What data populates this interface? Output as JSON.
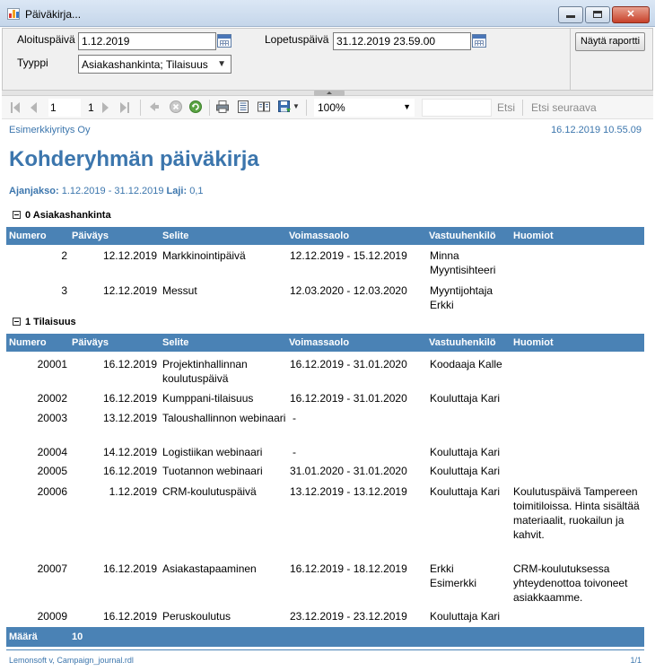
{
  "window": {
    "title": "Päiväkirja..."
  },
  "params": {
    "start_label": "Aloituspäivä",
    "start_value": "1.12.2019",
    "end_label": "Lopetuspäivä",
    "end_value": "31.12.2019 23.59.00",
    "type_label": "Tyyppi",
    "type_value": "Asiakashankinta; Tilaisuus",
    "report_button": "Näytä raportti"
  },
  "toolbar": {
    "page": "1",
    "page_count": "1",
    "zoom": "100%",
    "find_label": "Etsi",
    "find_next_label": "Etsi seuraava"
  },
  "report": {
    "company": "Esimerkkiyritys Oy",
    "printed": "16.12.2019 10.55.09",
    "title": "Kohderyhmän päiväkirja",
    "period_label": "Ajanjakso:",
    "period_value": "1.12.2019 - 31.12.2019",
    "type_label": "Laji:",
    "type_value": "0,1",
    "columns": [
      "Numero",
      "Päiväys",
      "Selite",
      "Voimassaolo",
      "Vastuuhenkilö",
      "Huomiot"
    ],
    "groups": [
      {
        "title": "0 Asiakashankinta",
        "rows": [
          {
            "num": "2",
            "date": "12.12.2019",
            "desc": "Markkinointipäivä",
            "valid": "12.12.2019 - 15.12.2019",
            "owner": "Minna Myyntisihteeri",
            "note": ""
          },
          {
            "num": "3",
            "date": "12.12.2019",
            "desc": "Messut",
            "valid": "12.03.2020 - 12.03.2020",
            "owner": "Myyntijohtaja Erkki",
            "note": ""
          }
        ]
      },
      {
        "title": "1 Tilaisuus",
        "rows": [
          {
            "num": "20001",
            "date": "16.12.2019",
            "desc": "Projektinhallinnan koulutuspäivä",
            "valid": "16.12.2019 - 31.01.2020",
            "owner": "Koodaaja Kalle",
            "note": ""
          },
          {
            "num": "20002",
            "date": "16.12.2019",
            "desc": "Kumppani-tilaisuus",
            "valid": "16.12.2019 - 31.01.2020",
            "owner": "Kouluttaja Kari",
            "note": ""
          },
          {
            "num": "20003",
            "date": "13.12.2019",
            "desc": "Taloushallinnon webinaari",
            "valid": "-",
            "owner": "",
            "note": ""
          },
          {
            "num": "20004",
            "date": "14.12.2019",
            "desc": "Logistiikan webinaari",
            "valid": "-",
            "owner": "Kouluttaja Kari",
            "note": ""
          },
          {
            "num": "20005",
            "date": "16.12.2019",
            "desc": "Tuotannon webinaari",
            "valid": "31.01.2020 - 31.01.2020",
            "owner": "Kouluttaja Kari",
            "note": ""
          },
          {
            "num": "20006",
            "date": "1.12.2019",
            "desc": "CRM-koulutuspäivä",
            "valid": "13.12.2019 - 13.12.2019",
            "owner": "Kouluttaja Kari",
            "note": "Koulutuspäivä Tampereen toimitiloissa. Hinta sisältää materiaalit, ruokailun ja kahvit."
          },
          {
            "num": "20007",
            "date": "16.12.2019",
            "desc": "Asiakastapaaminen",
            "valid": "16.12.2019 - 18.12.2019",
            "owner": "Erkki Esimerkki",
            "note": "CRM-koulutuksessa yhteydenottoa toivoneet asiakkaamme."
          },
          {
            "num": "20009",
            "date": "16.12.2019",
            "desc": "Peruskoulutus",
            "valid": "23.12.2019 - 23.12.2019",
            "owner": "Kouluttaja Kari",
            "note": ""
          }
        ]
      }
    ],
    "total_label": "Määrä",
    "total_value": "10",
    "footer_left": "Lemonsoft v, Campaign_journal.rdl",
    "footer_right": "1/1"
  }
}
